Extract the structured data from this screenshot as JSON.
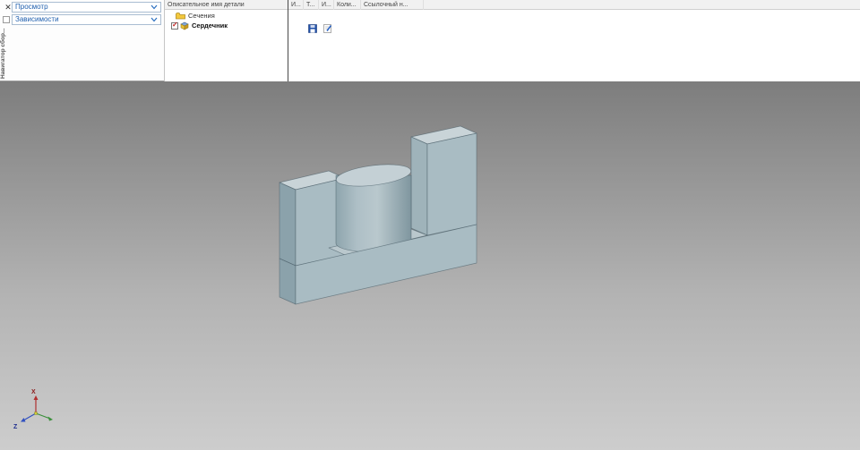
{
  "window": {
    "panel_title": "Навигатор сбор..."
  },
  "left_panel": {
    "close_glyph": "✕",
    "view_combo_label": "Просмотр",
    "dependencies_combo_label": "Зависимости"
  },
  "assembly_table": {
    "columns": [
      "Описательное имя детали",
      "И...",
      "Т...",
      "И...",
      "Коли...",
      "Ссылочный н..."
    ],
    "rows": [
      {
        "name": "Сечения",
        "icon": "folder-icon"
      },
      {
        "name": "Сердечник",
        "icon": "part-icon",
        "check_glyph": "✓"
      }
    ]
  },
  "viewport": {
    "part_name": "Сердечник",
    "triad": {
      "x_label": "X",
      "z_label": "Z"
    },
    "background_top": "#7d7d7d",
    "background_bottom": "#cdcdcd"
  },
  "model": {
    "face_top_color": "#c9d4d8",
    "face_front_color": "#a9bcc3",
    "face_side_color": "#8ba2ab",
    "floor_color": "#bac8cd"
  },
  "accent_color": "#1f5fae"
}
